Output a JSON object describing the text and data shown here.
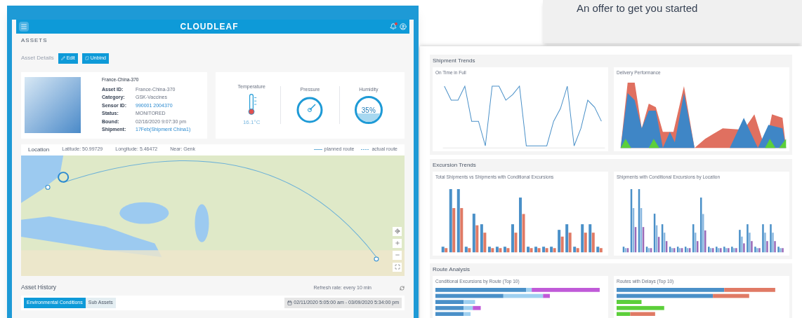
{
  "promo": {
    "text": "An offer to get you started"
  },
  "app": {
    "logo": "CLOUDLEAF",
    "notifications": true,
    "section": "ASSETS",
    "details_title": "Asset Details",
    "buttons": [
      {
        "label": "Edit",
        "kind": "edit"
      },
      {
        "label": "Unbind",
        "kind": "unbind"
      }
    ],
    "asset": {
      "name": "France-China-370",
      "fields": [
        {
          "label": "Asset ID:",
          "value": "France-China-370",
          "kind": "text"
        },
        {
          "label": "Category:",
          "value": "GSK-Vaccines",
          "kind": "text"
        },
        {
          "label": "Sensor ID:",
          "value": "990001 2004370",
          "kind": "link"
        },
        {
          "label": "Status:",
          "value": "MONITORED",
          "kind": "text"
        },
        {
          "label": "Bound:",
          "value": "02/16/2020 9:07:30 pm",
          "kind": "text"
        },
        {
          "label": "Shipment:",
          "value": "17Feb(Shipment China1)",
          "kind": "link"
        }
      ]
    },
    "sensors": [
      {
        "label": "Temperature",
        "kind": "thermometer",
        "reading": "16.1°C"
      },
      {
        "label": "Pressure",
        "kind": "gauge"
      },
      {
        "label": "Humidity",
        "kind": "humidity",
        "reading": "35%",
        "level": 0.35
      }
    ],
    "location": {
      "title": "Location",
      "latitude": "Latitude: 50.99729",
      "longitude": "Longitude: 5.46472",
      "near": "Near: Genk",
      "legend": [
        {
          "label": "planned route",
          "kind": "solid"
        },
        {
          "label": "actual route",
          "kind": "dashed"
        }
      ]
    },
    "history": {
      "title": "Asset History",
      "refresh": "Refresh rate: every 10 min",
      "tabs": [
        {
          "label": "Environmental Conditions",
          "selected": true
        },
        {
          "label": "Sub Assets",
          "selected": false
        }
      ],
      "date_range": "02/11/2020 5:05:00 am - 03/09/2020 5:34:00 pm"
    }
  },
  "dashboard": {
    "sections": [
      {
        "title": "Shipment Trends",
        "charts": [
          {
            "title": "On Time in Full",
            "kind": "line"
          },
          {
            "title": "Delivery Performance",
            "kind": "area"
          }
        ]
      },
      {
        "title": "Excursion Trends",
        "charts": [
          {
            "title": "Total Shipments vs Shipments with Conditional Excursions",
            "kind": "bars2"
          },
          {
            "title": "Shipments with Conditional Excursions by Location",
            "kind": "bars4"
          }
        ]
      },
      {
        "title": "Route Analysis",
        "charts": [
          {
            "title": "Conditional Excursions by Route (Top 10)",
            "kind": "hbar"
          },
          {
            "title": "Routes with Delays (Top 10)",
            "kind": "hbar2"
          }
        ]
      }
    ]
  }
}
